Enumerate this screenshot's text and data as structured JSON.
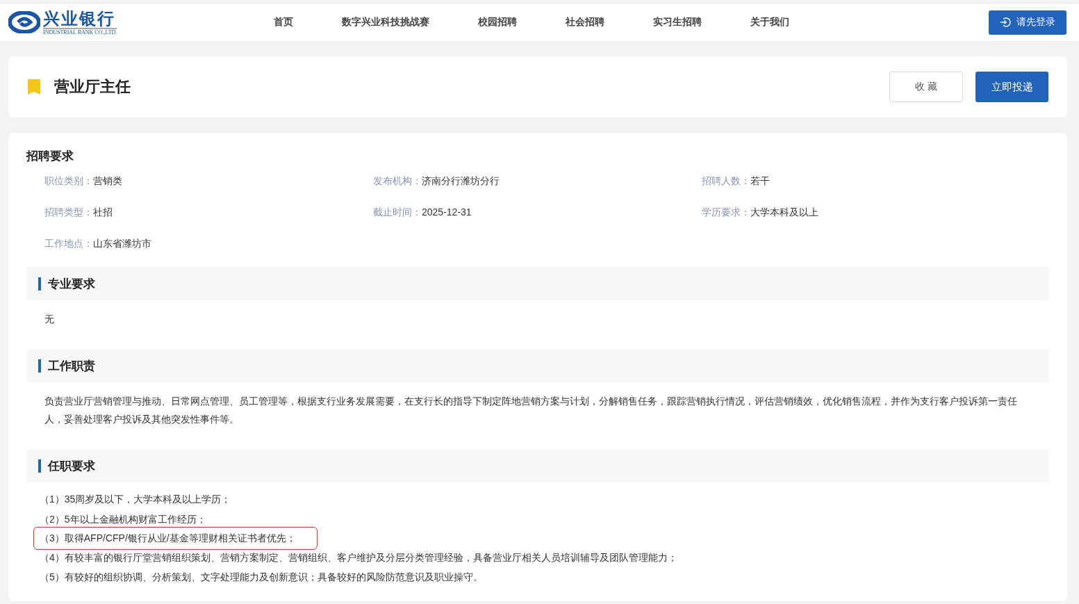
{
  "header": {
    "logo": {
      "name": "兴业银行",
      "subtitle": "INDUSTRIAL BANK CO.,LTD."
    },
    "nav": [
      {
        "label": "首页"
      },
      {
        "label": "数字兴业科技挑战赛"
      },
      {
        "label": "校园招聘"
      },
      {
        "label": "社会招聘"
      },
      {
        "label": "实习生招聘"
      },
      {
        "label": "关于我们"
      }
    ],
    "login_button": "请先登录"
  },
  "job": {
    "title": "营业厅主任",
    "favorite_button": "收 藏",
    "apply_button": "立即投递"
  },
  "recruitment": {
    "heading": "招聘要求",
    "fields": [
      {
        "label": "职位类别：",
        "value": "营销类"
      },
      {
        "label": "发布机构：",
        "value": "济南分行潍坊分行"
      },
      {
        "label": "招聘人数：",
        "value": "若干"
      },
      {
        "label": "招聘类型：",
        "value": "社招"
      },
      {
        "label": "截止时间：",
        "value": "2025-12-31"
      },
      {
        "label": "学历要求：",
        "value": "大学本科及以上"
      },
      {
        "label": "工作地点：",
        "value": "山东省潍坊市"
      }
    ]
  },
  "sections": [
    {
      "heading": "专业要求",
      "paragraphs": [
        "无"
      ]
    },
    {
      "heading": "工作职责",
      "paragraphs": [
        "负责营业厅营销管理与推动、日常网点管理、员工管理等，根据支行业务发展需要，在支行长的指导下制定阵地营销方案与计划，分解销售任务，跟踪营销执行情况，评估营销绩效，优化销售流程，并作为支行客户投诉第一责任人，妥善处理客户投诉及其他突发性事件等。"
      ]
    },
    {
      "heading": "任职要求",
      "items": [
        {
          "text": "（1）35周岁及以下，大学本科及以上学历；",
          "highlighted": false
        },
        {
          "text": "（2）5年以上金融机构财富工作经历；",
          "highlighted": false
        },
        {
          "text": "（3）取得AFP/CFP/银行从业/基金等理财相关证书者优先；",
          "highlighted": true
        },
        {
          "text": "（4）有较丰富的银行厅堂营销组织策划、营销方案制定、营销组织、客户维护及分层分类管理经验，具备营业厅相关人员培训辅导及团队管理能力；",
          "highlighted": false
        },
        {
          "text": "（5）有较好的组织协调、分析策划、文字处理能力及创新意识；具备较好的风险防范意识及职业操守。",
          "highlighted": false
        }
      ]
    }
  ]
}
